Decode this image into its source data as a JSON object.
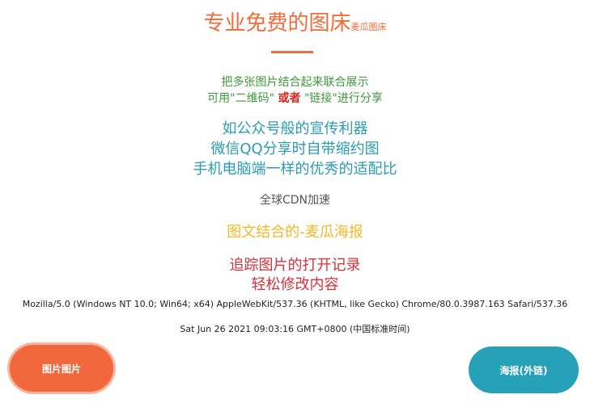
{
  "header": {
    "title": "专业免费的图床",
    "subtitle": "麦瓜图床"
  },
  "intro": {
    "line1": "把多张图片结合起来联合展示",
    "line2_prefix": "可用\"二维码\" ",
    "line2_highlight": "或者",
    "line2_suffix": " \"链接\"进行分享"
  },
  "features_teal": [
    "如公众号般的宣传利器",
    "微信QQ分享时自带缩约图",
    "手机电脑端一样的优秀的适配比"
  ],
  "cdn": "全球CDN加速",
  "poster_feature": "图文结合的-麦瓜海报",
  "tracking": [
    "追踪图片的打开记录",
    "轻松修改内容"
  ],
  "user_agent": "Mozilla/5.0 (Windows NT 10.0; Win64; x64) AppleWebKit/537.36 (KHTML, like Gecko) Chrome/80.0.3987.163 Safari/537.36",
  "datetime": "Sat Jun 26 2021 09:03:16 GMT+0800 (中国标准时间)",
  "buttons": {
    "left_label": "图片图片",
    "right_label": "海报(外链)"
  },
  "colors": {
    "accent_orange": "#f26b3a",
    "green": "#3c9a3a",
    "red_highlight": "#e0221b",
    "teal": "#2b9bb3",
    "yellow": "#f1b928",
    "red": "#d6303a"
  }
}
